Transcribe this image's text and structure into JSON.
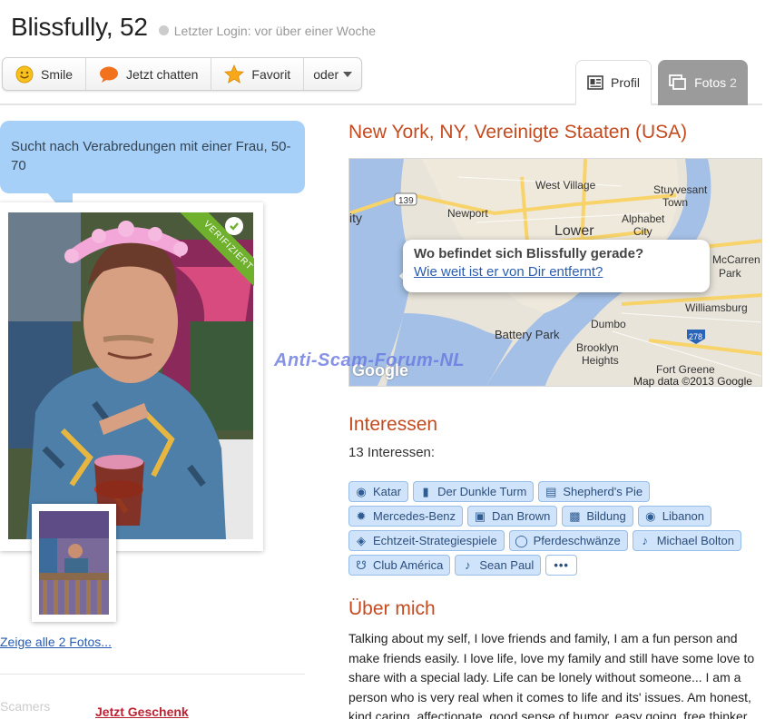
{
  "header": {
    "name": "Blissfully, 52",
    "last_login": "Letzter Login: vor über einer Woche"
  },
  "actions": {
    "smile": "Smile",
    "chat": "Jetzt chatten",
    "favorite": "Favorit",
    "more": "oder"
  },
  "tabs": {
    "profile": "Profil",
    "photos": "Fotos",
    "photos_count": "2"
  },
  "bubble": {
    "text": "Sucht nach Verabredungen mit einer Frau, 50-70"
  },
  "photo": {
    "verified": "VERIFIZIERT"
  },
  "show_all_photos": "Zeige alle 2 Fotos...",
  "gift_link": "Jetzt Geschenk",
  "watermark_bottom": "Scamers",
  "location": "New York, NY, Vereinigte Staaten (USA)",
  "map": {
    "question": "Wo befindet sich Blissfully gerade?",
    "link": "Wie weit ist er von Dir entfernt?",
    "credit": "Map data ©2013 Google",
    "google": "Google",
    "labels": [
      "Newport",
      "West Village",
      "Stuyvesant Town",
      "Alphabet City",
      "Lower",
      "McCarren Park",
      "Williamsburg",
      "Battery Park",
      "Dumbo",
      "Brooklyn Heights",
      "Fort Greene",
      "139",
      "278",
      "Ity"
    ]
  },
  "watermark": "Anti-Scam-Forum-NL",
  "interests": {
    "heading": "Interessen",
    "count": "13 Interessen:",
    "rows": [
      [
        {
          "label": "Katar",
          "icon": "globe-icon"
        },
        {
          "label": "Der Dunkle Turm",
          "icon": "book-icon"
        },
        {
          "label": "Shepherd's Pie",
          "icon": "food-icon"
        }
      ],
      [
        {
          "label": "Mercedes-Benz",
          "icon": "wrench-icon"
        },
        {
          "label": "Dan Brown",
          "icon": "tv-icon"
        },
        {
          "label": "Bildung",
          "icon": "briefcase-icon"
        },
        {
          "label": "Libanon",
          "icon": "globe-icon"
        }
      ],
      [
        {
          "label": "Echtzeit-Strategiespiele",
          "icon": "game-icon"
        },
        {
          "label": "Pferdeschwänze",
          "icon": "ring-icon"
        },
        {
          "label": "Michael Bolton",
          "icon": "music-icon"
        }
      ],
      [
        {
          "label": "Club América",
          "icon": "trophy-icon"
        },
        {
          "label": "Sean Paul",
          "icon": "music-icon"
        }
      ]
    ],
    "more": "•••"
  },
  "about": {
    "heading": "Über mich",
    "text": "Talking about my self, I love friends and family, I am a fun person and make friends easily. I love life, love my family and still have some love to share with a special lady. Life can be lonely without someone... I am a person who is very real when it comes to life and its' issues. Am honest, kind caring, affectionate, good sense of humor, easy going, free thinker"
  },
  "colors": {
    "accent_red": "#c44a1f",
    "link_blue": "#2a5db0",
    "bubble_blue": "#a6d0f7",
    "tag_bg": "#cfe3fa",
    "verified_green": "#6fb12c"
  }
}
